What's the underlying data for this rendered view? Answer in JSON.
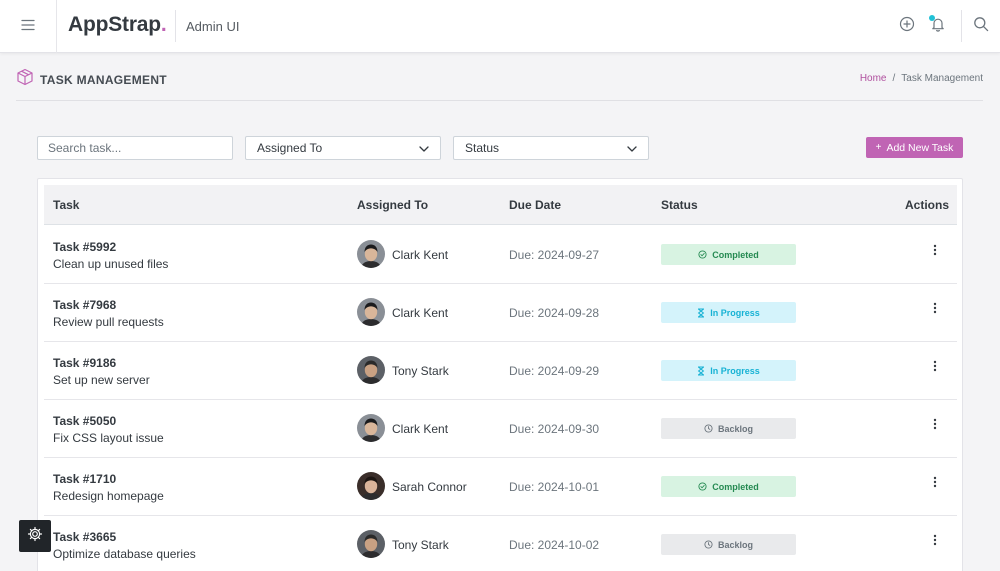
{
  "header": {
    "brand_main": "AppStrap",
    "brand_dot": ".",
    "subtitle": "Admin UI",
    "icons": [
      "menu-icon",
      "add-circle-icon",
      "bell-icon",
      "search-icon"
    ],
    "notification_dot_color": "#21c1d6"
  },
  "page": {
    "title": "TASK MANAGEMENT",
    "title_icon": "box-icon",
    "breadcrumb": {
      "home": "Home",
      "separator": "/",
      "current": "Task Management"
    }
  },
  "controls": {
    "search_placeholder": "Search task...",
    "assigned_select": "Assigned To",
    "status_select": "Status",
    "add_button_icon": "+",
    "add_button_label": "Add New Task"
  },
  "table": {
    "columns": {
      "task": "Task",
      "assigned": "Assigned To",
      "due": "Due Date",
      "status": "Status",
      "actions": "Actions"
    },
    "rows": [
      {
        "id": "Task #5992",
        "name": "Clean up unused files",
        "assignee": "Clark Kent",
        "due": "Due: 2024-09-27",
        "status": "Completed",
        "status_type": "completed"
      },
      {
        "id": "Task #7968",
        "name": "Review pull requests",
        "assignee": "Clark Kent",
        "due": "Due: 2024-09-28",
        "status": "In Progress",
        "status_type": "progress"
      },
      {
        "id": "Task #9186",
        "name": "Set up new server",
        "assignee": "Tony Stark",
        "due": "Due: 2024-09-29",
        "status": "In Progress",
        "status_type": "progress"
      },
      {
        "id": "Task #5050",
        "name": "Fix CSS layout issue",
        "assignee": "Clark Kent",
        "due": "Due: 2024-09-30",
        "status": "Backlog",
        "status_type": "backlog"
      },
      {
        "id": "Task #1710",
        "name": "Redesign homepage",
        "assignee": "Sarah Connor",
        "due": "Due: 2024-10-01",
        "status": "Completed",
        "status_type": "completed"
      },
      {
        "id": "Task #3665",
        "name": "Optimize database queries",
        "assignee": "Tony Stark",
        "due": "Due: 2024-10-02",
        "status": "Backlog",
        "status_type": "backlog"
      }
    ]
  },
  "colors": {
    "accent": "#c064b4",
    "completed_bg": "#d8f3e2",
    "completed_text": "#258a52",
    "progress_bg": "#d4f3fb",
    "progress_text": "#17b2d4",
    "backlog_bg": "#e9eaec",
    "backlog_text": "#6c757d"
  },
  "settings_icon": "gear-icon"
}
